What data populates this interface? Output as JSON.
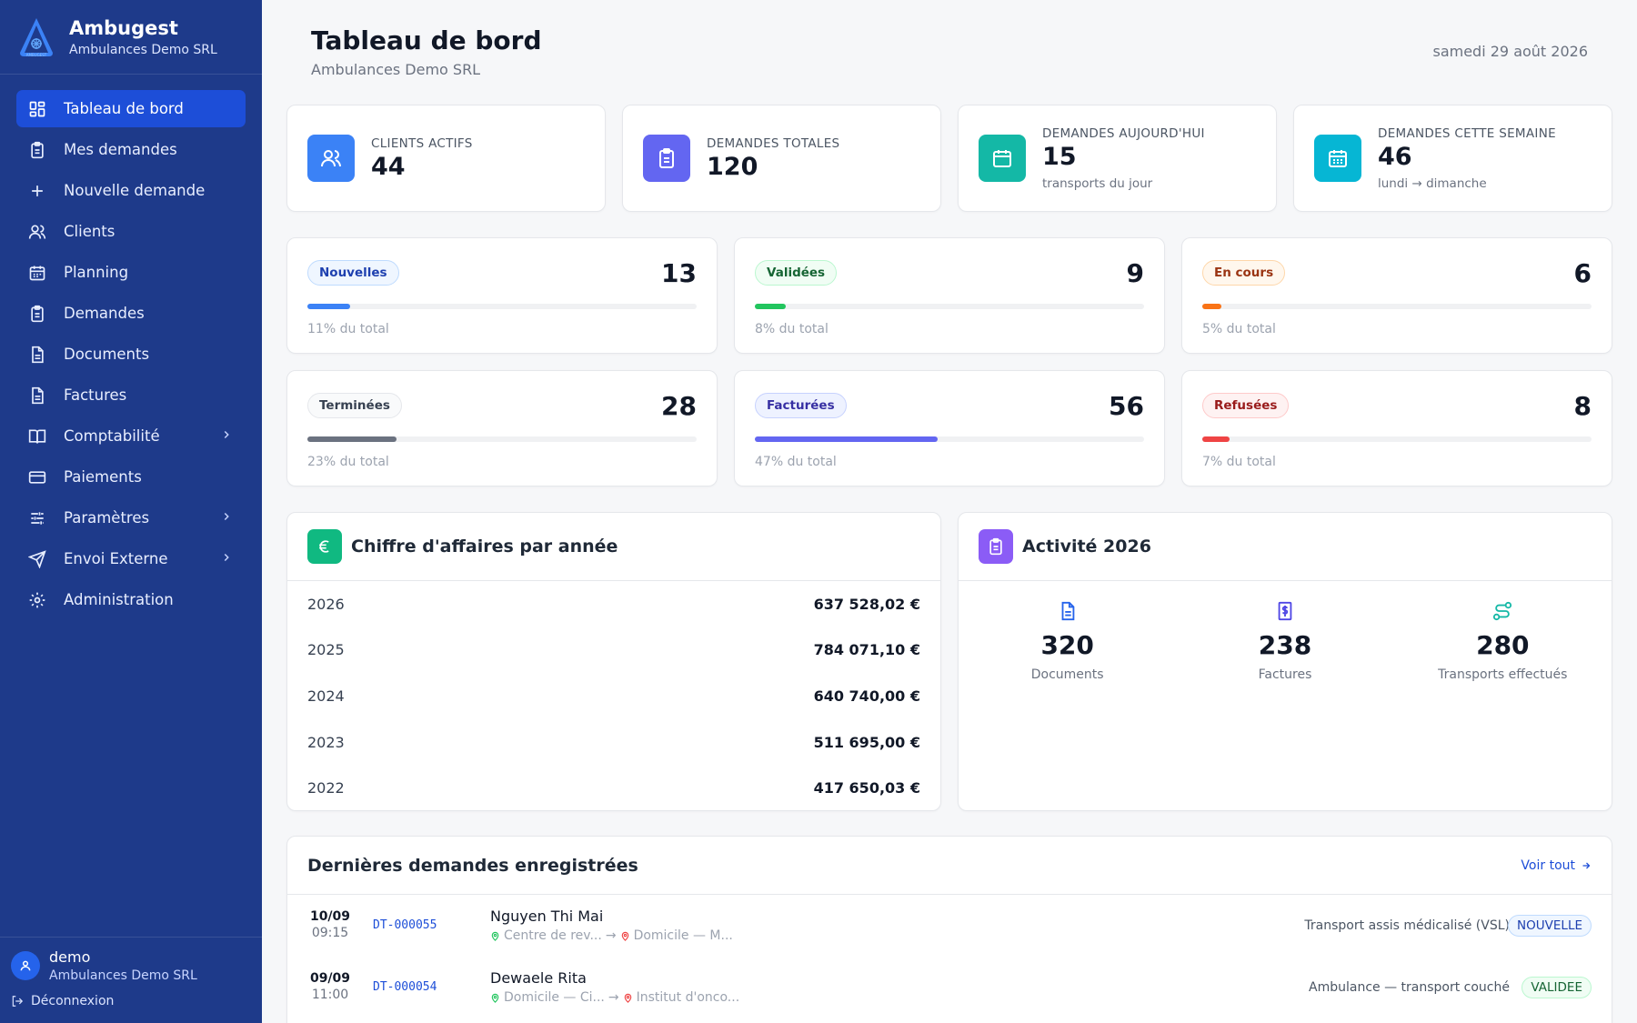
{
  "brand": {
    "name": "Ambugest",
    "subtitle": "Ambulances Demo SRL",
    "logo_text": "AMBUGEST"
  },
  "nav": [
    {
      "label": "Tableau de bord",
      "icon": "dashboard-icon",
      "active": true
    },
    {
      "label": "Mes demandes",
      "icon": "clipboard-icon"
    },
    {
      "label": "Nouvelle demande",
      "icon": "plus-icon"
    },
    {
      "label": "Clients",
      "icon": "users-icon"
    },
    {
      "label": "Planning",
      "icon": "calendar-icon"
    },
    {
      "label": "Demandes",
      "icon": "clipboard-icon"
    },
    {
      "label": "Documents",
      "icon": "document-icon"
    },
    {
      "label": "Factures",
      "icon": "document-icon"
    },
    {
      "label": "Comptabilité",
      "icon": "book-icon",
      "expandable": true
    },
    {
      "label": "Paiements",
      "icon": "credit-card-icon"
    },
    {
      "label": "Paramètres",
      "icon": "sliders-icon",
      "expandable": true
    },
    {
      "label": "Envoi Externe",
      "icon": "send-icon",
      "expandable": true
    },
    {
      "label": "Administration",
      "icon": "gear-icon"
    }
  ],
  "user": {
    "name": "demo",
    "org": "Ambulances Demo SRL",
    "logout_label": "Déconnexion"
  },
  "header": {
    "title": "Tableau de bord",
    "subtitle": "Ambulances Demo SRL",
    "date": "samedi 29 août 2026"
  },
  "kpis": [
    {
      "label": "CLIENTS ACTIFS",
      "value": "44",
      "note": "",
      "icon": "users-icon",
      "color": "#3b82f6"
    },
    {
      "label": "DEMANDES TOTALES",
      "value": "120",
      "note": "",
      "icon": "clipboard-icon",
      "color": "#6366f1"
    },
    {
      "label": "DEMANDES AUJOURD'HUI",
      "value": "15",
      "note": "transports du jour",
      "icon": "calendar-icon",
      "color": "#14b8a6"
    },
    {
      "label": "DEMANDES CETTE SEMAINE",
      "value": "46",
      "note": "lundi → dimanche",
      "icon": "calendar-week-icon",
      "color": "#06b6d4"
    }
  ],
  "statuses": [
    {
      "label": "Nouvelles",
      "count": "13",
      "pct_label": "11% du total",
      "fraction": 0.11,
      "fill": "#3b82f6",
      "pill_text": "#1e40af",
      "pill_bg": "#eff6ff",
      "pill_border": "#bfdbfe"
    },
    {
      "label": "Validées",
      "count": "9",
      "pct_label": "8% du total",
      "fraction": 0.08,
      "fill": "#22c55e",
      "pill_text": "#166534",
      "pill_bg": "#f0fdf4",
      "pill_border": "#bbf7d0"
    },
    {
      "label": "En cours",
      "count": "6",
      "pct_label": "5% du total",
      "fraction": 0.05,
      "fill": "#f97316",
      "pill_text": "#9a3412",
      "pill_bg": "#fff7ed",
      "pill_border": "#fed7aa"
    },
    {
      "label": "Terminées",
      "count": "28",
      "pct_label": "23% du total",
      "fraction": 0.23,
      "fill": "#6b7280",
      "pill_text": "#374151",
      "pill_bg": "#f9fafb",
      "pill_border": "#e5e7eb"
    },
    {
      "label": "Facturées",
      "count": "56",
      "pct_label": "47% du total",
      "fraction": 0.47,
      "fill": "#6366f1",
      "pill_text": "#3730a3",
      "pill_bg": "#eef2ff",
      "pill_border": "#c7d2fe"
    },
    {
      "label": "Refusées",
      "count": "8",
      "pct_label": "7% du total",
      "fraction": 0.07,
      "fill": "#ef4444",
      "pill_text": "#991b1b",
      "pill_bg": "#fef2f2",
      "pill_border": "#fecaca"
    }
  ],
  "revenue": {
    "title": "Chiffre d'affaires par année",
    "icon": "euro-icon",
    "rows": [
      {
        "year": "2026",
        "amount": "637 528,02 €"
      },
      {
        "year": "2025",
        "amount": "784 071,10 €"
      },
      {
        "year": "2024",
        "amount": "640 740,00 €"
      },
      {
        "year": "2023",
        "amount": "511 695,00 €"
      },
      {
        "year": "2022",
        "amount": "417 650,03 €"
      }
    ]
  },
  "activity": {
    "title": "Activité 2026",
    "icon": "clipboard-icon",
    "items": [
      {
        "value": "320",
        "label": "Documents",
        "icon": "document-icon",
        "color": "#2563eb"
      },
      {
        "value": "238",
        "label": "Factures",
        "icon": "invoice-dollar-icon",
        "color": "#4f46e5"
      },
      {
        "value": "280",
        "label": "Transports effectués",
        "icon": "route-icon",
        "color": "#14b8a6"
      }
    ]
  },
  "recent": {
    "title": "Dernières demandes enregistrées",
    "see_all": "Voir tout",
    "rows": [
      {
        "date": "10/09",
        "time": "09:15",
        "id": "DT-000055",
        "name": "Nguyen Thi Mai",
        "from": "Centre de rev...",
        "to": "Domicile — M...",
        "type": "Transport assis médicalisé (VSL)",
        "status": "NOUVELLE",
        "status_text": "#1e40af",
        "status_bg": "#eff6ff",
        "status_border": "#bfdbfe"
      },
      {
        "date": "09/09",
        "time": "11:00",
        "id": "DT-000054",
        "name": "Dewaele Rita",
        "from": "Domicile — Ci...",
        "to": "Institut d'onco...",
        "type": "Ambulance — transport couché",
        "status": "VALIDEE",
        "status_text": "#166534",
        "status_bg": "#f0fdf4",
        "status_border": "#bbf7d0"
      }
    ]
  }
}
